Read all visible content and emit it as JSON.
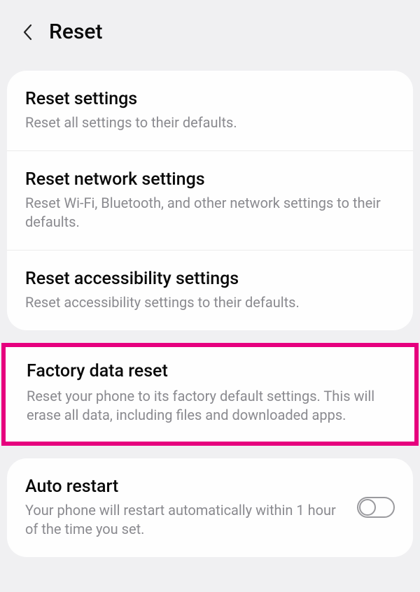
{
  "header": {
    "title": "Reset"
  },
  "items": [
    {
      "title": "Reset settings",
      "desc": "Reset all settings to their defaults."
    },
    {
      "title": "Reset network settings",
      "desc": "Reset Wi-Fi, Bluetooth, and other network settings to their defaults."
    },
    {
      "title": "Reset accessibility settings",
      "desc": "Reset accessibility settings to their defaults."
    },
    {
      "title": "Factory data reset",
      "desc": "Reset your phone to its factory default settings. This will erase all data, including files and downloaded apps."
    }
  ],
  "autoRestart": {
    "title": "Auto restart",
    "desc": "Your phone will restart automatically within 1 hour of the time you set.",
    "enabled": false
  }
}
